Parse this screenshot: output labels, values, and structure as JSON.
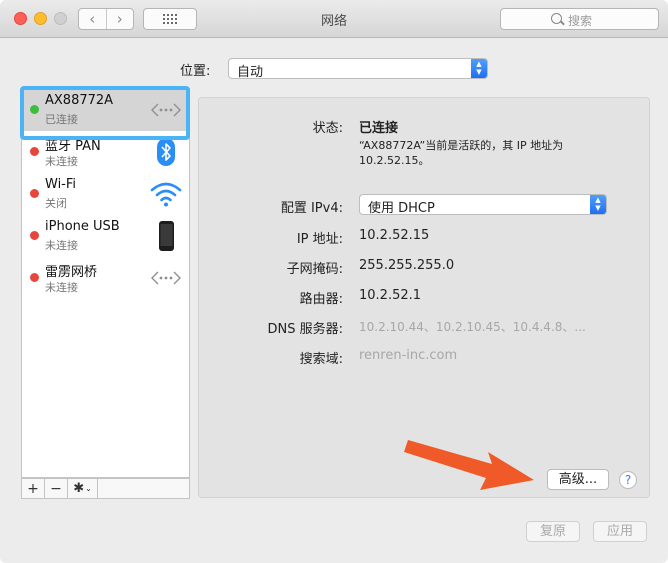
{
  "window": {
    "title": "网络",
    "nav_back": "‹",
    "nav_forward": "›",
    "search_placeholder": "搜索"
  },
  "location": {
    "label": "位置:",
    "value": "自动"
  },
  "services": [
    {
      "name": "AX88772A",
      "status": "已连接",
      "status_color": "#3dbd3d",
      "icon": "ethernet-icon",
      "selected": true
    },
    {
      "name": "蓝牙 PAN",
      "status": "未连接",
      "status_color": "#e8453c",
      "icon": "bluetooth-icon",
      "selected": false
    },
    {
      "name": "Wi-Fi",
      "status": "关闭",
      "status_color": "#e8453c",
      "icon": "wifi-icon",
      "selected": false
    },
    {
      "name": "iPhone USB",
      "status": "未连接",
      "status_color": "#e8453c",
      "icon": "iphone-icon",
      "selected": false
    },
    {
      "name": "雷雳网桥",
      "status": "未连接",
      "status_color": "#e8453c",
      "icon": "thunderbolt-bridge-icon",
      "selected": false
    }
  ],
  "list_toolbar": {
    "add": "+",
    "remove": "−",
    "gear": "✱",
    "caret": "⌄"
  },
  "details": {
    "status_label": "状态:",
    "status_value": "已连接",
    "status_desc_line1": "“AX88772A”当前是活跃的，其 IP 地址为",
    "status_desc_line2": "10.2.52.15。",
    "ipv4_label": "配置 IPv4:",
    "ipv4_value": "使用 DHCP",
    "ip_label": "IP 地址:",
    "ip_value": "10.2.52.15",
    "mask_label": "子网掩码:",
    "mask_value": "255.255.255.0",
    "router_label": "路由器:",
    "router_value": "10.2.52.1",
    "dns_label": "DNS 服务器:",
    "dns_value": "10.2.10.44、10.2.10.45、10.4.4.8、...",
    "search_domain_label": "搜索域:",
    "search_domain_value": "renren-inc.com",
    "advanced_button": "高级...",
    "help_button": "?"
  },
  "footer": {
    "revert_button": "复原",
    "apply_button": "应用"
  },
  "colors": {
    "selection_ring": "#4cb3f5",
    "accent_blue": "#1e6ff0",
    "annotation_arrow": "#f05a28"
  }
}
